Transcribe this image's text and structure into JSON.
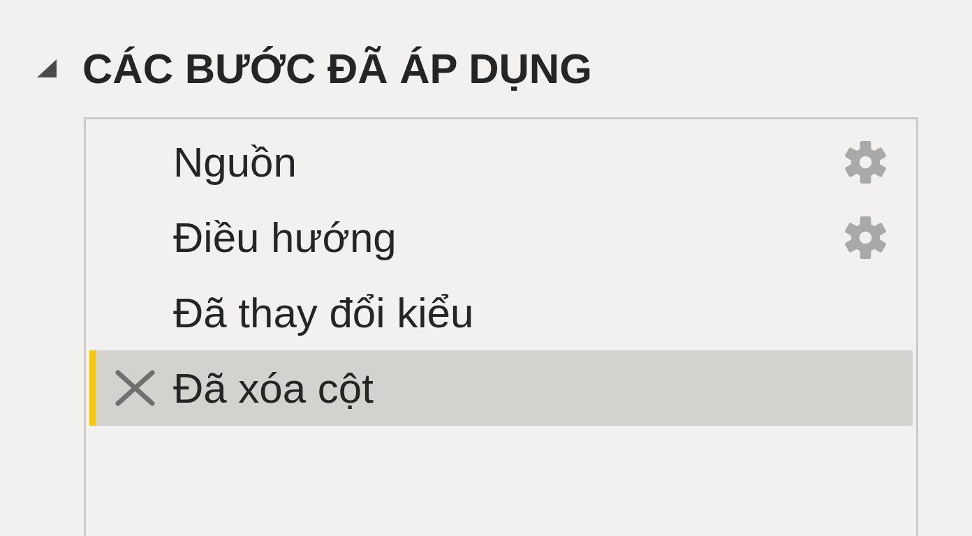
{
  "applied_steps": {
    "title": "CÁC BƯỚC ĐÃ ÁP DỤNG",
    "expanded": true,
    "steps": [
      {
        "label": "Nguồn",
        "kind": "settings",
        "selected": false
      },
      {
        "label": "Điều hướng",
        "kind": "settings",
        "selected": false
      },
      {
        "label": "Đã thay đổi kiểu",
        "kind": "plain",
        "selected": false
      },
      {
        "label": "Đã xóa cột",
        "kind": "plain",
        "selected": true
      }
    ]
  }
}
